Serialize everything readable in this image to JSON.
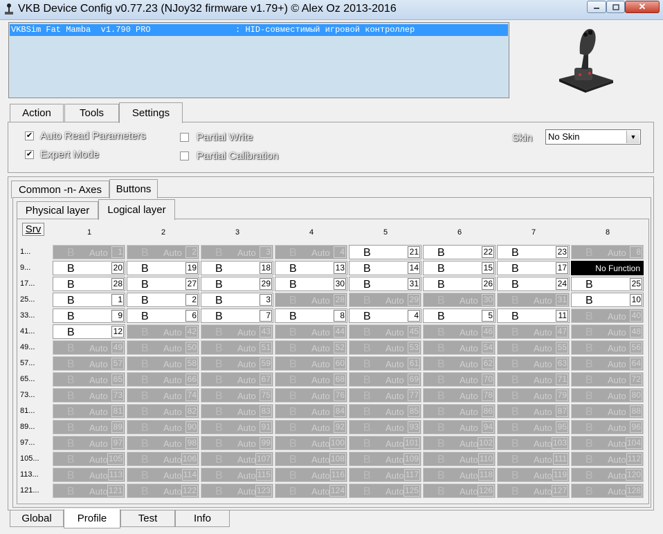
{
  "window": {
    "title": "VKB Device Config v0.77.23 (NJoy32 firmware v1.79+) © Alex Oz 2013-2016"
  },
  "device_list": {
    "rows": [
      "VKBSim Fat Mamba  v1.790 PRO                 : HID-совместимый игровой контроллер"
    ]
  },
  "main_tabs": [
    {
      "label": "Action",
      "selected": false
    },
    {
      "label": "Tools",
      "selected": false
    },
    {
      "label": "Settings",
      "selected": true
    }
  ],
  "settings": {
    "auto_read": {
      "label": "Auto Read Parameters",
      "checked": true
    },
    "expert_mode": {
      "label": "Expert Mode",
      "checked": true
    },
    "partial_write": {
      "label": "Partial Write",
      "checked": false
    },
    "partial_calibration": {
      "label": "Partial Calibration",
      "checked": false
    },
    "skin_label": "Skin",
    "skin_value": "No Skin"
  },
  "config_tabs": [
    {
      "label": "Common -n- Axes",
      "selected": false
    },
    {
      "label": "Buttons",
      "selected": true
    }
  ],
  "layer_tabs": [
    {
      "label": "Physical layer",
      "selected": false
    },
    {
      "label": "Logical layer",
      "selected": true
    }
  ],
  "grid": {
    "srv_label": "Srv",
    "auto_text": "Auto",
    "button_letter": "B",
    "no_function_text": "No Function",
    "columns": [
      "1",
      "2",
      "3",
      "4",
      "5",
      "6",
      "7",
      "8"
    ],
    "row_labels": [
      "1...",
      "9...",
      "17...",
      "25...",
      "33...",
      "41...",
      "49...",
      "57...",
      "65...",
      "73...",
      "81...",
      "89...",
      "97...",
      "105...",
      "113...",
      "121..."
    ],
    "manual_cells": {
      "1": [
        null,
        null,
        null,
        null,
        21,
        22,
        23,
        null
      ],
      "9": [
        20,
        19,
        18,
        13,
        14,
        15,
        17,
        "nofn"
      ],
      "17": [
        28,
        27,
        29,
        30,
        31,
        26,
        24,
        25
      ],
      "25": [
        1,
        2,
        3,
        null,
        null,
        null,
        null,
        10
      ],
      "33": [
        9,
        6,
        7,
        8,
        4,
        5,
        11,
        null
      ],
      "41": [
        12,
        null,
        null,
        null,
        null,
        null,
        null,
        null
      ]
    }
  },
  "bottom_tabs": [
    {
      "label": "Global",
      "selected": false
    },
    {
      "label": "Profile",
      "selected": true
    },
    {
      "label": "Test",
      "selected": false
    },
    {
      "label": "Info",
      "selected": false
    }
  ]
}
